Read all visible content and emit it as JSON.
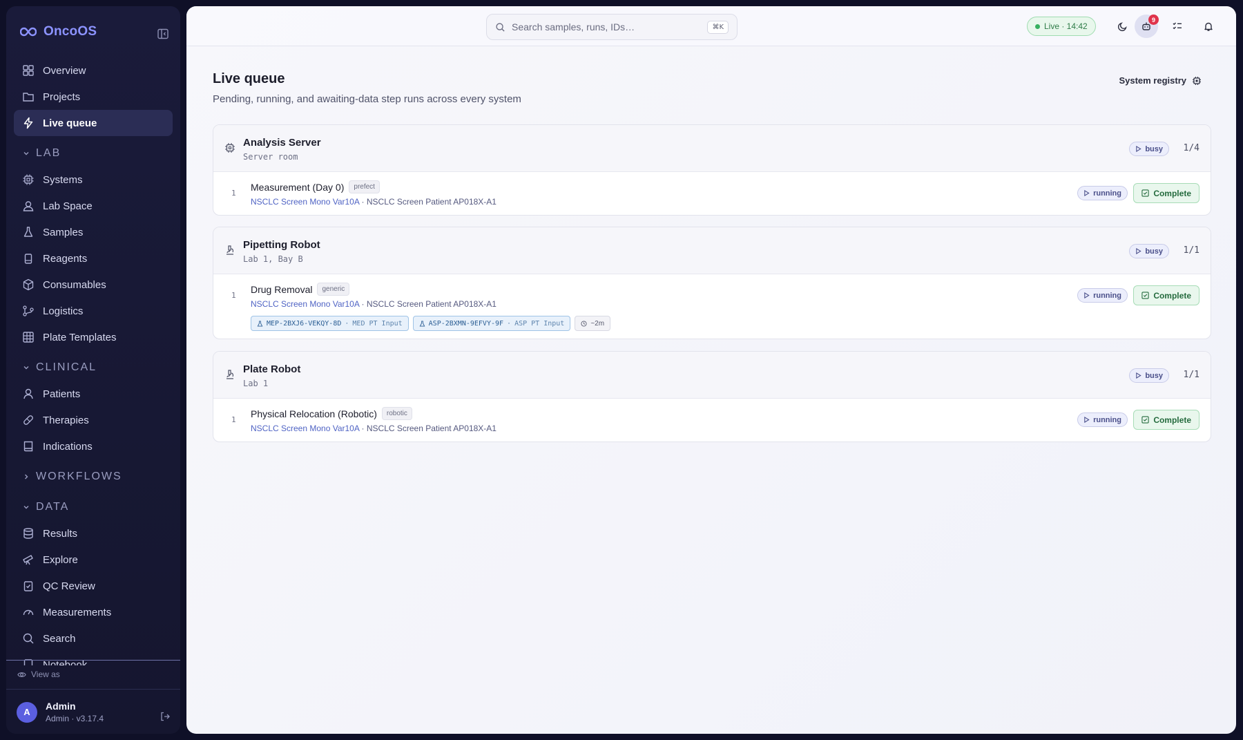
{
  "app": {
    "name": "OncoOS"
  },
  "sidebar": {
    "top_items": [
      {
        "label": "Overview"
      },
      {
        "label": "Projects"
      },
      {
        "label": "Live queue"
      }
    ],
    "sections": [
      {
        "label": "LAB",
        "items": [
          {
            "label": "Systems"
          },
          {
            "label": "Lab Space"
          },
          {
            "label": "Samples"
          },
          {
            "label": "Reagents"
          },
          {
            "label": "Consumables"
          },
          {
            "label": "Logistics"
          },
          {
            "label": "Plate Templates"
          }
        ]
      },
      {
        "label": "CLINICAL",
        "items": [
          {
            "label": "Patients"
          },
          {
            "label": "Therapies"
          },
          {
            "label": "Indications"
          }
        ]
      },
      {
        "label": "WORKFLOWS"
      },
      {
        "label": "DATA",
        "items": [
          {
            "label": "Results"
          },
          {
            "label": "Explore"
          },
          {
            "label": "QC Review"
          },
          {
            "label": "Measurements"
          },
          {
            "label": "Search"
          },
          {
            "label": "Notebook"
          }
        ]
      }
    ],
    "view_as": "View as",
    "user": {
      "initial": "A",
      "name": "Admin",
      "sub": "Admin · v3.17.4"
    }
  },
  "topbar": {
    "search_placeholder": "Search samples, runs, IDs…",
    "search_shortcut": "⌘K",
    "live_label": "Live · 14:42",
    "notification_count": "9"
  },
  "page": {
    "title": "Live queue",
    "subtitle": "Pending, running, and awaiting-data step runs across every system",
    "registry_label": "System registry"
  },
  "systems": [
    {
      "name": "Analysis Server",
      "location": "Server room",
      "status": "busy",
      "count": "1/4",
      "run": {
        "num": "1",
        "name": "Measurement (Day 0)",
        "tag": "prefect",
        "project": "NSCLC Screen Mono Var10A",
        "separator": " · ",
        "patient": "NSCLC Screen Patient AP018X-A1",
        "status": "running",
        "action": "Complete"
      }
    },
    {
      "name": "Pipetting Robot",
      "location": "Lab 1, Bay B",
      "status": "busy",
      "count": "1/1",
      "run": {
        "num": "1",
        "name": "Drug Removal",
        "tag": "generic",
        "project": "NSCLC Screen Mono Var10A",
        "separator": " · ",
        "patient": "NSCLC Screen Patient AP018X-A1",
        "status": "running",
        "action": "Complete",
        "chips": [
          {
            "id": "MEP-2BXJ6-VEKQY-8D",
            "sep": "·",
            "role": "MED PT Input"
          },
          {
            "id": "ASP-2BXMN-9EFVY-9F",
            "sep": "·",
            "role": "ASP PT Input"
          }
        ],
        "eta": "~2m"
      }
    },
    {
      "name": "Plate Robot",
      "location": "Lab 1",
      "status": "busy",
      "count": "1/1",
      "run": {
        "num": "1",
        "name": "Physical Relocation (Robotic)",
        "tag": "robotic",
        "project": "NSCLC Screen Mono Var10A",
        "separator": " · ",
        "patient": "NSCLC Screen Patient AP018X-A1",
        "status": "running",
        "action": "Complete"
      }
    }
  ]
}
